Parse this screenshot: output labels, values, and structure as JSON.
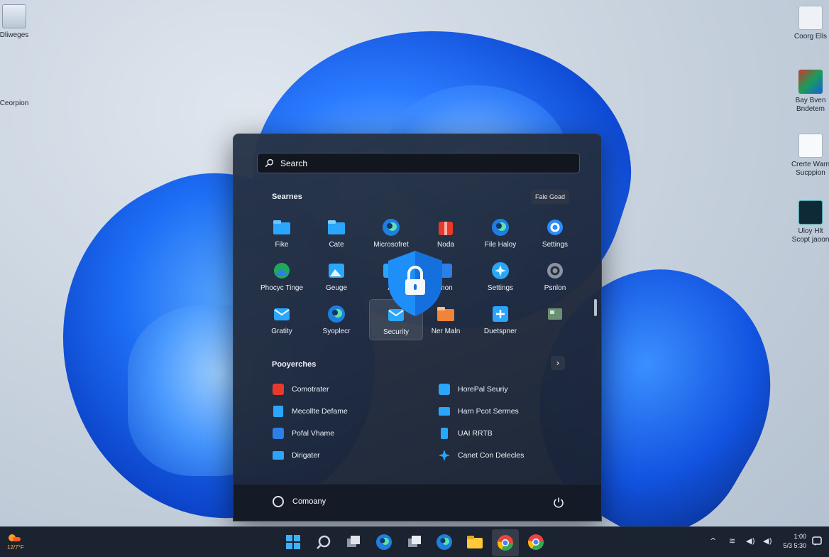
{
  "desktop": {
    "icons": [
      {
        "label": "Dliweges"
      },
      {
        "label": "Ceorpion"
      },
      {
        "label": "Coorg Ells"
      },
      {
        "label": "Bay Bven Bndetem"
      },
      {
        "label": "Crerte Warn Sucppion"
      },
      {
        "label": "Uloy Hlt Scopt jaoon"
      }
    ]
  },
  "start_menu": {
    "search": {
      "placeholder": "Search"
    },
    "pinned": {
      "title": "Searnes",
      "all_apps_label": "Fale Goad",
      "apps": [
        {
          "label": "Fike"
        },
        {
          "label": "Cate"
        },
        {
          "label": "Microsofret"
        },
        {
          "label": "Noda"
        },
        {
          "label": "File Haloy"
        },
        {
          "label": "Settings"
        },
        {
          "label": "Phocyc Tinge"
        },
        {
          "label": "Geuge"
        },
        {
          "label": "Al"
        },
        {
          "label": "mon"
        },
        {
          "label": "Settings"
        },
        {
          "label": "Psnlon"
        },
        {
          "label": "Gratity"
        },
        {
          "label": "Syoplecr"
        },
        {
          "label": "Security"
        },
        {
          "label": "Ner Maln"
        },
        {
          "label": "Duetspner"
        },
        {
          "label": ""
        }
      ]
    },
    "recommended": {
      "title": "Pooyerches",
      "more_label": "›",
      "items": [
        {
          "label": "Comotrater"
        },
        {
          "label": "HorePal Seuriy"
        },
        {
          "label": "Mecollte Defame"
        },
        {
          "label": "Harn Pcot Sermes"
        },
        {
          "label": "Pofal Vhame"
        },
        {
          "label": "UAI RRTB"
        },
        {
          "label": "Dirigater"
        },
        {
          "label": "Canet Con Delecles"
        }
      ]
    },
    "user": {
      "name": "Comoany"
    }
  },
  "taskbar": {
    "weather": "12/7°F",
    "clock_time": "1:00",
    "clock_date": "5/3 5:30"
  },
  "colors": {
    "accent": "#1d6ef5",
    "start_bg": "#243046",
    "taskbar_bg": "#1b2230"
  }
}
